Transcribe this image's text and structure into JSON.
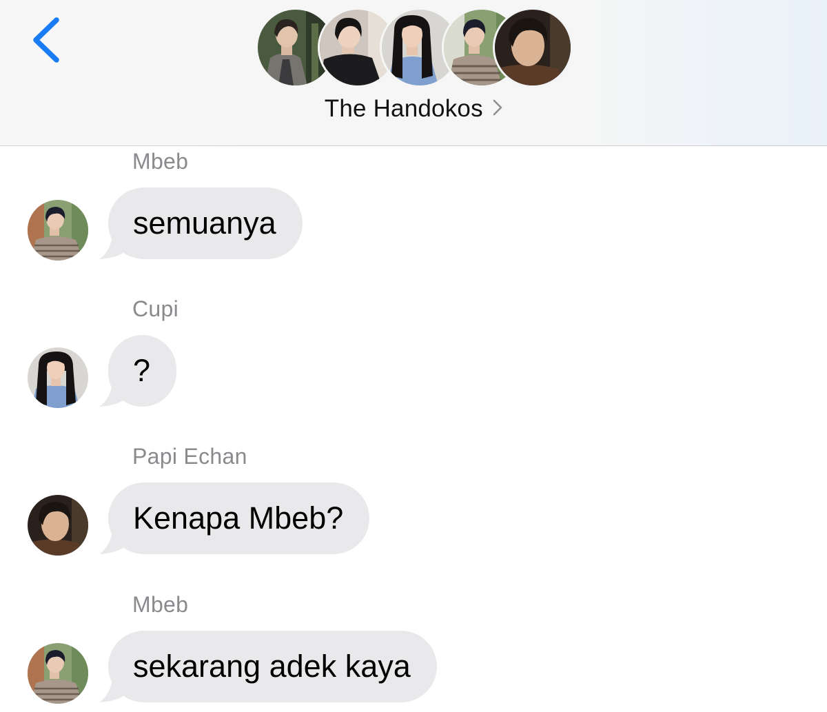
{
  "header": {
    "group_name": "The Handokos",
    "back_icon": "chevron-left-icon",
    "disclosure_icon": "chevron-right-icon",
    "member_avatars": [
      {
        "name": "member-avatar-1"
      },
      {
        "name": "member-avatar-2"
      },
      {
        "name": "member-avatar-3"
      },
      {
        "name": "member-avatar-4"
      },
      {
        "name": "member-avatar-5"
      }
    ],
    "accent_color": "#1a7cf5"
  },
  "messages": [
    {
      "sender": "Mbeb",
      "text": "semuanya"
    },
    {
      "sender": "Cupi",
      "text": "?"
    },
    {
      "sender": "Papi Echan",
      "text": "Kenapa Mbeb?"
    },
    {
      "sender": "Mbeb",
      "text": "sekarang adek kaya"
    }
  ],
  "colors": {
    "bubble": "#e9e9eb",
    "sender_name": "#8a8a8e",
    "header_bg": "#f6f6f6"
  }
}
